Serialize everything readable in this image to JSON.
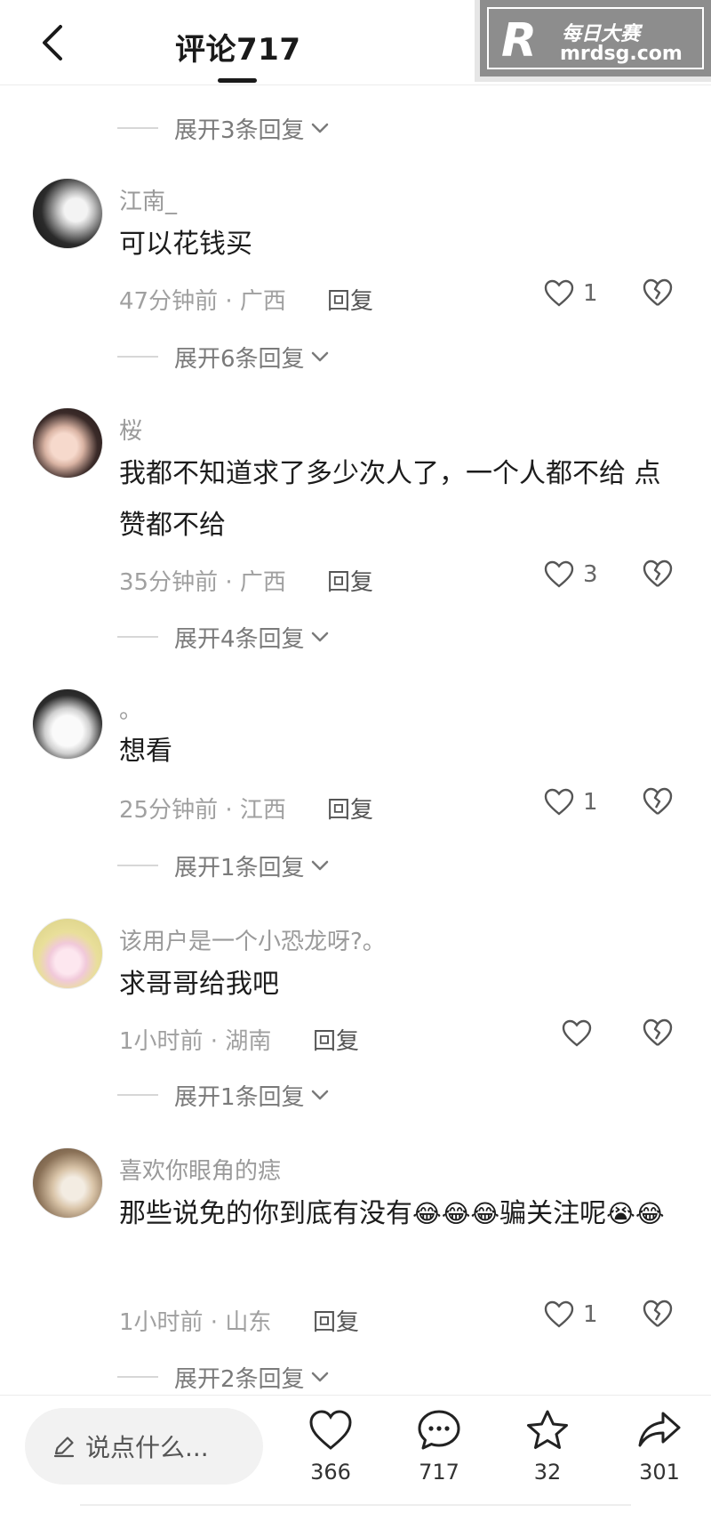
{
  "header": {
    "title": "评论717"
  },
  "watermark": {
    "logo": "R",
    "name": "每日大赛",
    "url": "mrdsg.com"
  },
  "expand_top": "展开3条回复",
  "comments": [
    {
      "username": "江南_",
      "text": "可以花钱买",
      "meta": "47分钟前 · 广西",
      "reply": "回复",
      "likes": "1",
      "expand": "展开6条回复"
    },
    {
      "username": "桜",
      "text": "我都不知道求了多少次人了，一个人都不给 点赞都不给",
      "meta": "35分钟前 · 广西",
      "reply": "回复",
      "likes": "3",
      "expand": "展开4条回复"
    },
    {
      "username": "。",
      "text": "想看",
      "meta": "25分钟前 · 江西",
      "reply": "回复",
      "likes": "1",
      "expand": "展开1条回复"
    },
    {
      "username": "该用户是一个小恐龙呀?。",
      "text": "求哥哥给我吧",
      "meta": "1小时前 · 湖南",
      "reply": "回复",
      "likes": "",
      "expand": "展开1条回复"
    },
    {
      "username": "喜欢你眼角的痣",
      "text_before": "那些说免的你到底有没有",
      "emoji_a": "😂😂😂",
      "text_after": "骗关注呢",
      "emoji_b": "😭😂",
      "meta": "1小时前 · 山东",
      "reply": "回复",
      "likes": "1",
      "expand": "展开2条回复"
    }
  ],
  "bottom_bar": {
    "input_placeholder": "说点什么...",
    "likes": "366",
    "comments": "717",
    "favorites": "32",
    "shares": "301"
  }
}
